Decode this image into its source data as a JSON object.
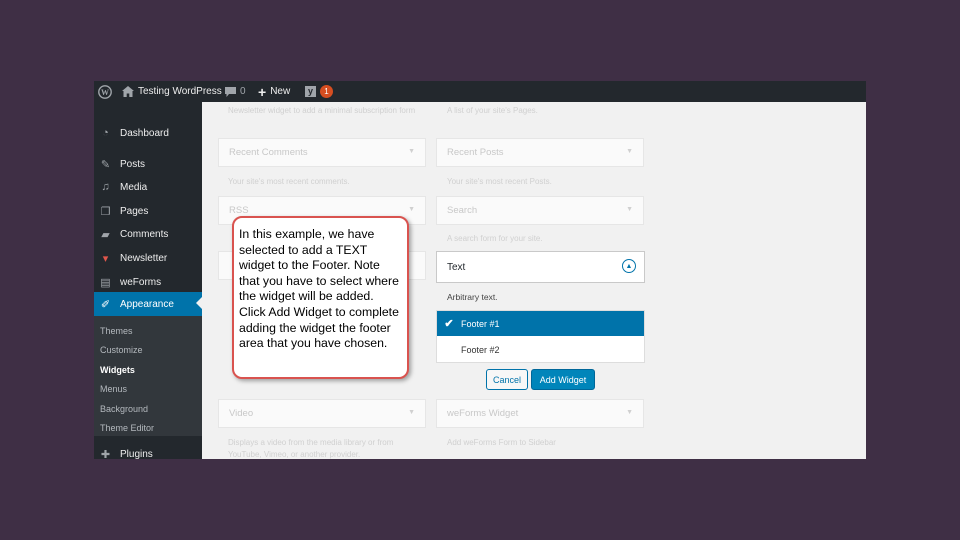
{
  "adminbar": {
    "site_name": "Testing WordPress",
    "comment_count": "0",
    "new_label": "New",
    "notification_count": "1"
  },
  "sidebar": {
    "items": [
      {
        "label": "Dashboard",
        "icon": "dashboard-icon"
      },
      {
        "label": "Posts",
        "icon": "pin-icon"
      },
      {
        "label": "Media",
        "icon": "media-icon"
      },
      {
        "label": "Pages",
        "icon": "pages-icon"
      },
      {
        "label": "Comments",
        "icon": "comment-icon"
      },
      {
        "label": "Newsletter",
        "icon": "newsletter-icon"
      },
      {
        "label": "weForms",
        "icon": "weforms-icon"
      },
      {
        "label": "Appearance",
        "icon": "brush-icon"
      },
      {
        "label": "Plugins",
        "icon": "plugin-icon"
      }
    ],
    "submenu": [
      "Themes",
      "Customize",
      "Widgets",
      "Menus",
      "Background",
      "Theme Editor"
    ],
    "current_submenu": "Widgets"
  },
  "widgets": {
    "newsletter_desc": "Newsletter widget to add a minimal subscription form",
    "pages_desc": "A list of your site's Pages.",
    "recent_comments": {
      "title": "Recent Comments",
      "desc": "Your site's most recent comments."
    },
    "recent_posts": {
      "title": "Recent Posts",
      "desc": "Your site's most recent Posts."
    },
    "rss": {
      "title": "RSS"
    },
    "search": {
      "title": "Search",
      "desc": "A search form for your site."
    },
    "video": {
      "title": "Video",
      "desc": "Displays a video from the media library or from YouTube, Vimeo, or another provider."
    },
    "weforms": {
      "title": "weForms Widget",
      "desc": "Add weForms Form to Sidebar"
    }
  },
  "chooser": {
    "widget_title": "Text",
    "description": "Arbitrary text.",
    "options": [
      "Footer #1",
      "Footer #2"
    ],
    "selected": "Footer #1",
    "cancel_label": "Cancel",
    "add_label": "Add Widget"
  },
  "callout": {
    "text": "In this example, we have selected to add a TEXT widget to the Footer. Note that you have to select where the widget will be added.  Click Add Widget to complete adding the widget the footer area that you have chosen."
  },
  "colors": {
    "accent": "#0073aa",
    "sidebar_bg": "#23282d",
    "callout_border": "#d9534f",
    "background": "#3f2f45"
  }
}
